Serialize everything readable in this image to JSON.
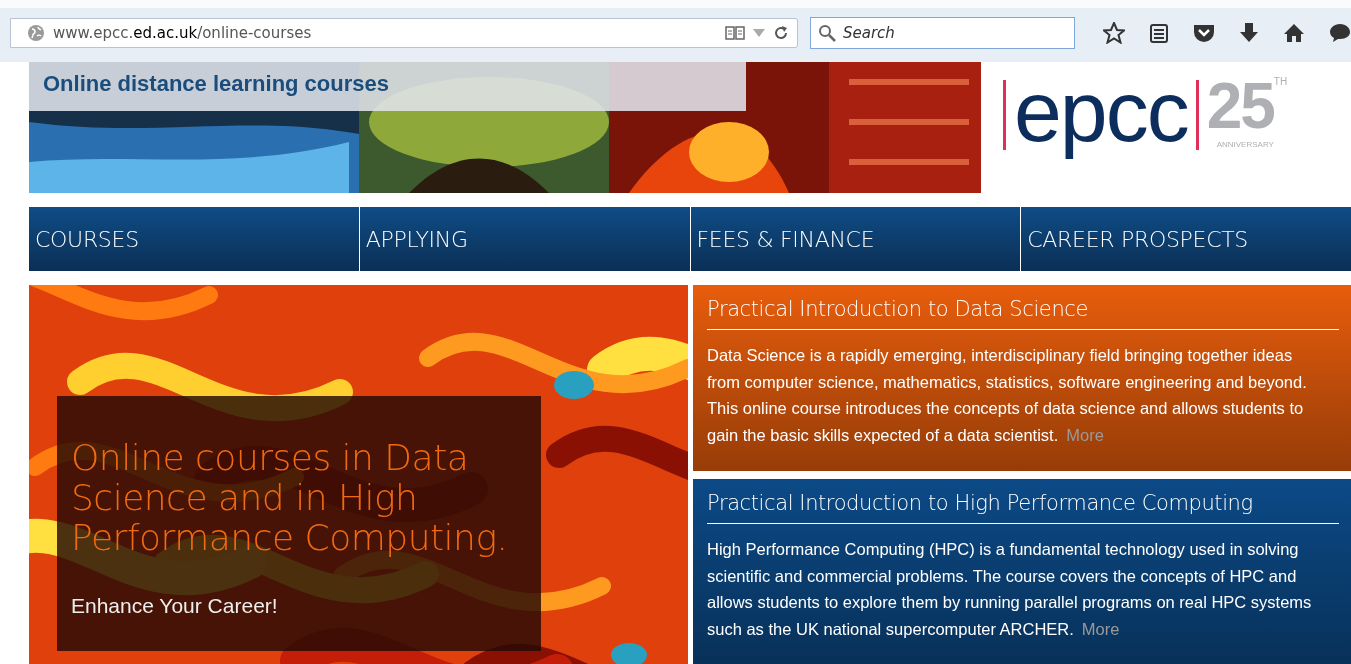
{
  "browser": {
    "url": "www.epcc.**ed.ac.uk**/online-courses",
    "search": {
      "placeholder": "Search"
    }
  },
  "banner": {
    "title": "Online distance learning courses",
    "logo": {
      "wordmark": "epcc",
      "number": "25",
      "suffix": "TH",
      "caption": "ANNIVERSARY"
    }
  },
  "nav": [
    {
      "label": "COURSES"
    },
    {
      "label": "APPLYING"
    },
    {
      "label": "FEES & FINANCE"
    },
    {
      "label": "CAREER PROSPECTS"
    }
  ],
  "hero": {
    "heading": "Online courses in Data Science and in High Performance Computing.",
    "tagline": "Enhance Your Career!"
  },
  "courses": [
    {
      "title": "Practical Introduction to Data Science",
      "text": "Data Science is a rapidly emerging, interdisciplinary field bringing together ideas from computer science, mathematics, statistics, software engineering and beyond. This online course introduces the concepts of data science and allows students to gain the basic skills expected of a data scientist.",
      "link": "More",
      "color": "#e85d0c"
    },
    {
      "title": "Practical Introduction to High Performance Computing",
      "text": "High Performance Computing (HPC) is a fundamental technology used in solving scientific and commercial problems. The course covers the concepts of HPC and allows students to explore them by running parallel programs on real HPC systems such as the UK national supercomputer ARCHER.",
      "link": "More",
      "color": "#0c4a87"
    }
  ]
}
